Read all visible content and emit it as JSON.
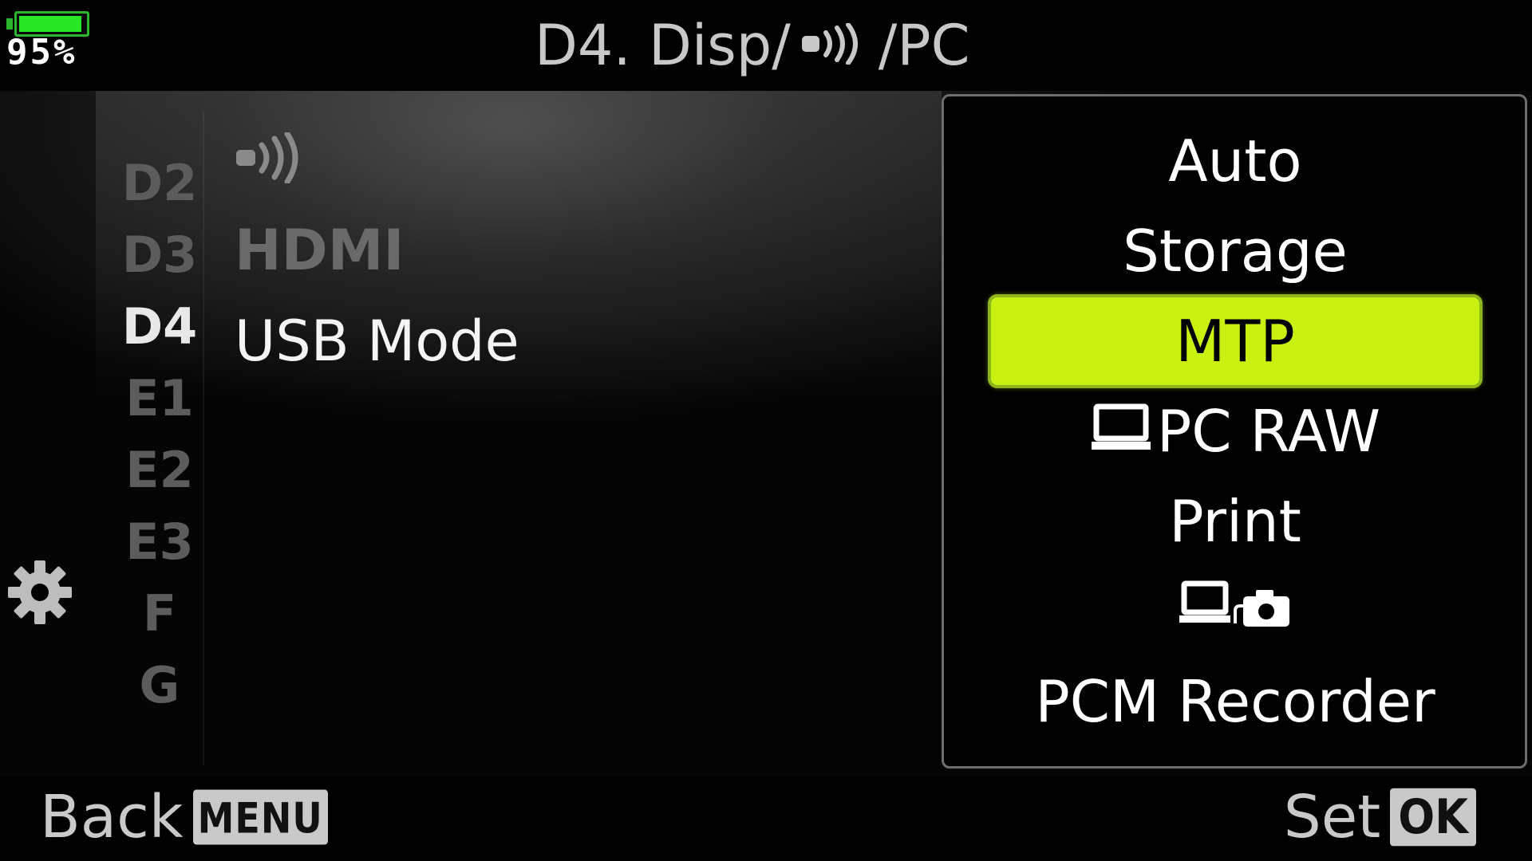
{
  "battery": {
    "percent_label": "95%",
    "level": 0.95,
    "color": "#29e829"
  },
  "title": {
    "prefix": "D4. Disp/",
    "icon": "wifi-icon",
    "suffix": "/PC"
  },
  "tabs": [
    {
      "label": "D2",
      "active": false
    },
    {
      "label": "D3",
      "active": false
    },
    {
      "label": "D4",
      "active": true
    },
    {
      "label": "E1",
      "active": false
    },
    {
      "label": "E2",
      "active": false
    },
    {
      "label": "E3",
      "active": false
    },
    {
      "label": "F",
      "active": false
    },
    {
      "label": "G",
      "active": false
    }
  ],
  "sidebar_icon": "gear-icon",
  "menu": {
    "wifi_icon": "wifi-icon",
    "hdmi_label": "HDMI",
    "usb_label": "USB Mode"
  },
  "options": [
    {
      "label": "Auto",
      "selected": false
    },
    {
      "label": "Storage",
      "selected": false
    },
    {
      "label": "MTP",
      "selected": true
    },
    {
      "label": "PC RAW",
      "icon": "pc-icon",
      "selected": false
    },
    {
      "label": "Print",
      "selected": false
    },
    {
      "label": "",
      "icon": "pc-tether-camera-icon",
      "selected": false
    },
    {
      "label": "PCM Recorder",
      "selected": false
    }
  ],
  "selected_color": "#c8f010",
  "footer": {
    "back_label": "Back",
    "back_key": "MENU",
    "set_label": "Set",
    "set_key": "OK"
  }
}
